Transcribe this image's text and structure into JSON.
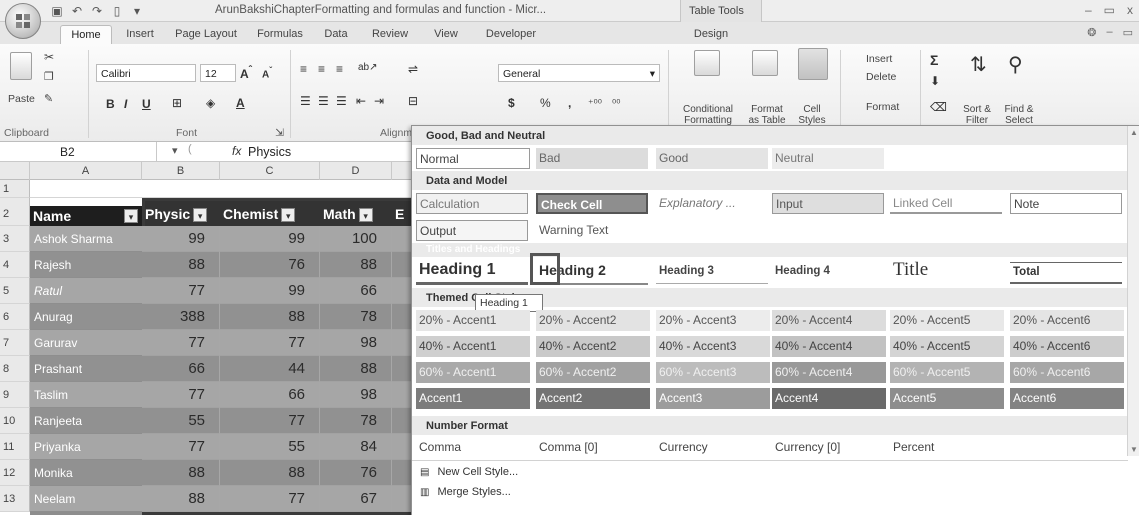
{
  "window": {
    "office_button": "",
    "title": "ArunBakshiChapterFormatting and formulas and function - Micr...",
    "table_tools": "Table Tools",
    "minimize": "–",
    "restore": "▭",
    "close": "x"
  },
  "tabs": [
    "Home",
    "Insert",
    "Page Layout",
    "Formulas",
    "Data",
    "Review",
    "View",
    "Developer",
    "Design"
  ],
  "ribbon": {
    "clipboard": {
      "paste": "Paste",
      "label": "Clipboard"
    },
    "font": {
      "name": "Calibri",
      "size": "12",
      "label": "Font"
    },
    "alignment": {
      "label": "Alignm"
    },
    "number": {
      "format": "General",
      "currency": "$",
      "percent": "%",
      "comma": ","
    },
    "styles": {
      "conditional": "Conditional Formatting",
      "format_table": "Format as Table",
      "cell_styles": "Cell Styles"
    },
    "cells": {
      "insert": "Insert",
      "delete": "Delete",
      "format": "Format"
    },
    "editing": {
      "sum": "Σ",
      "sort": "Sort & Filter",
      "find": "Find & Select"
    }
  },
  "formula_bar": {
    "name_box": "B2",
    "fx": "fx",
    "value": "Physics"
  },
  "sheet": {
    "columns": [
      "A",
      "B",
      "C",
      "D"
    ],
    "rows": [
      "1",
      "2",
      "3",
      "4",
      "5",
      "6",
      "7",
      "8",
      "9",
      "10",
      "11",
      "12",
      "13"
    ],
    "headers": [
      "Name",
      "Physic",
      "Chemist",
      "Math",
      "E"
    ],
    "data": [
      {
        "name": "Ashok Sharma",
        "v": [
          "99",
          "99",
          "100"
        ]
      },
      {
        "name": "Rajesh",
        "v": [
          "88",
          "76",
          "88"
        ]
      },
      {
        "name": "Ratul",
        "v": [
          "77",
          "99",
          "66"
        ]
      },
      {
        "name": "Anurag",
        "v": [
          "388",
          "88",
          "78"
        ]
      },
      {
        "name": "Garurav",
        "v": [
          "77",
          "77",
          "98"
        ]
      },
      {
        "name": "Prashant",
        "v": [
          "66",
          "44",
          "88"
        ]
      },
      {
        "name": "Taslim",
        "v": [
          "77",
          "66",
          "98"
        ]
      },
      {
        "name": "Ranjeeta",
        "v": [
          "55",
          "77",
          "78"
        ]
      },
      {
        "name": "Priyanka",
        "v": [
          "77",
          "55",
          "84"
        ]
      },
      {
        "name": "Monika",
        "v": [
          "88",
          "88",
          "76"
        ]
      },
      {
        "name": "Neelam",
        "v": [
          "88",
          "77",
          "67"
        ]
      }
    ]
  },
  "gallery": {
    "sections": [
      "Good, Bad and Neutral",
      "Data and Model",
      "Titles and Headings",
      "Themed Cell Styles",
      "Number Format"
    ],
    "good_bad": [
      "Normal",
      "Bad",
      "Good",
      "Neutral"
    ],
    "data_model_1": [
      "Calculation",
      "Check Cell",
      "Explanatory ...",
      "Input",
      "Linked Cell",
      "Note"
    ],
    "data_model_2": [
      "Output",
      "Warning Text"
    ],
    "headings": [
      "Heading 1",
      "Heading 2",
      "Heading 3",
      "Heading 4",
      "Title",
      "Total"
    ],
    "accent20": [
      "20% - Accent1",
      "20% - Accent2",
      "20% - Accent3",
      "20% - Accent4",
      "20% - Accent5",
      "20% - Accent6"
    ],
    "accent40": [
      "40% - Accent1",
      "40% - Accent2",
      "40% - Accent3",
      "40% - Accent4",
      "40% - Accent5",
      "40% - Accent6"
    ],
    "accent60": [
      "60% - Accent1",
      "60% - Accent2",
      "60% - Accent3",
      "60% - Accent4",
      "60% - Accent5",
      "60% - Accent6"
    ],
    "accent": [
      "Accent1",
      "Accent2",
      "Accent3",
      "Accent4",
      "Accent5",
      "Accent6"
    ],
    "number_format": [
      "Comma",
      "Comma [0]",
      "Currency",
      "Currency [0]",
      "Percent"
    ],
    "tooltip": "Heading 1",
    "new_style": "New Cell Style...",
    "merge_styles": "Merge Styles..."
  }
}
